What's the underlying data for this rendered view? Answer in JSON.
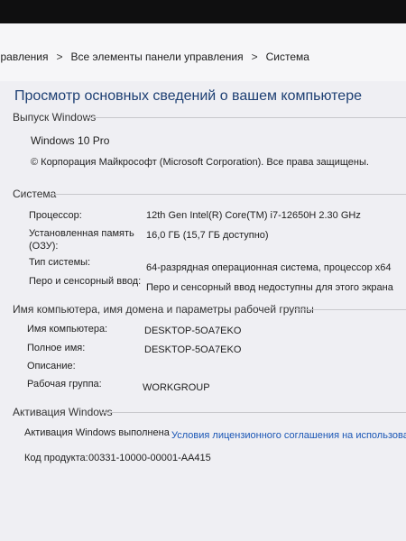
{
  "breadcrumb": {
    "items": [
      "правления",
      "Все элементы панели управления",
      "Система"
    ],
    "separator": ">"
  },
  "page_title": "Просмотр основных сведений о вашем компьютере",
  "windows_edition": {
    "heading": "Выпуск Windows",
    "edition": "Windows 10 Pro",
    "copyright": "© Корпорация Майкрософт (Microsoft Corporation). Все права защищены."
  },
  "system": {
    "heading": "Система",
    "rows": [
      {
        "label": "Процессор:",
        "value": "12th Gen Intel(R) Core(TM) i7-12650H   2.30 GHz"
      },
      {
        "label": "Установленная память (ОЗУ):",
        "value": "16,0 ГБ (15,7 ГБ доступно)"
      },
      {
        "label": "Тип системы:",
        "value": "64-разрядная операционная система, процессор x64"
      },
      {
        "label": "Перо и сенсорный ввод:",
        "value": "Перо и сенсорный ввод недоступны для этого экрана"
      }
    ]
  },
  "computer_name": {
    "heading": "Имя компьютера, имя домена и параметры рабочей группы",
    "rows": [
      {
        "label": "Имя компьютера:",
        "value": "DESKTOP-5OA7EKO"
      },
      {
        "label": "Полное имя:",
        "value": "DESKTOP-5OA7EKO"
      },
      {
        "label": "Описание:",
        "value": ""
      },
      {
        "label": "Рабочая группа:",
        "value": "WORKGROUP"
      }
    ]
  },
  "activation": {
    "heading": "Активация Windows",
    "status": "Активация Windows выполнена",
    "license_link": "Условия лицензионного соглашения на использова",
    "product_key_label": "Код продукта:",
    "product_key": "00331-10000-00001-AA415"
  },
  "colors": {
    "title": "#1d3f73",
    "link": "#1a56b5",
    "background": "#efeff3"
  }
}
